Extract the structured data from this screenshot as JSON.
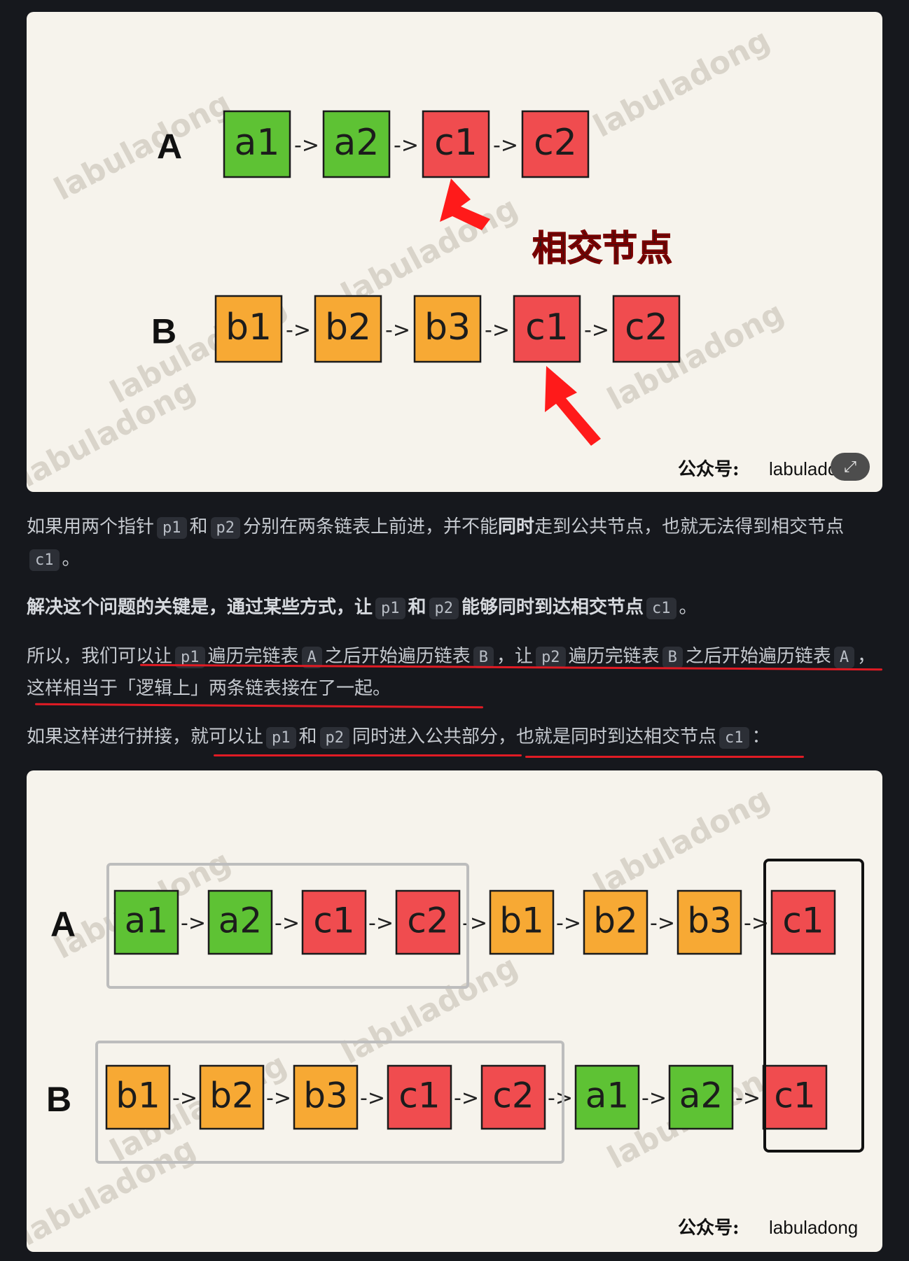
{
  "colors": {
    "green": "#5ec234",
    "orange": "#f7a934",
    "red": "#f04c4f",
    "arrow_red": "#ff1a1a",
    "underline_red": "#e01b24"
  },
  "figure1": {
    "row_a": {
      "label": "A",
      "nodes": [
        {
          "text": "a1",
          "color": "green"
        },
        {
          "text": "a2",
          "color": "green"
        },
        {
          "text": "c1",
          "color": "red"
        },
        {
          "text": "c2",
          "color": "red"
        }
      ]
    },
    "row_b": {
      "label": "B",
      "nodes": [
        {
          "text": "b1",
          "color": "orange"
        },
        {
          "text": "b2",
          "color": "orange"
        },
        {
          "text": "b3",
          "color": "orange"
        },
        {
          "text": "c1",
          "color": "red"
        },
        {
          "text": "c2",
          "color": "red"
        }
      ]
    },
    "arrow_text": "->",
    "callout": "相交节点",
    "credit_brand": "公众号:",
    "credit_name": "labuladong",
    "watermark": "labuladong",
    "expand_icon": "⤢"
  },
  "figure2": {
    "row_a": {
      "label": "A",
      "nodes": [
        {
          "text": "a1",
          "color": "green"
        },
        {
          "text": "a2",
          "color": "green"
        },
        {
          "text": "c1",
          "color": "red"
        },
        {
          "text": "c2",
          "color": "red"
        },
        {
          "text": "b1",
          "color": "orange"
        },
        {
          "text": "b2",
          "color": "orange"
        },
        {
          "text": "b3",
          "color": "orange"
        },
        {
          "text": "c1",
          "color": "red"
        }
      ]
    },
    "row_b": {
      "label": "B",
      "nodes": [
        {
          "text": "b1",
          "color": "orange"
        },
        {
          "text": "b2",
          "color": "orange"
        },
        {
          "text": "b3",
          "color": "orange"
        },
        {
          "text": "c1",
          "color": "red"
        },
        {
          "text": "c2",
          "color": "red"
        },
        {
          "text": "a1",
          "color": "green"
        },
        {
          "text": "a2",
          "color": "green"
        },
        {
          "text": "c1",
          "color": "red"
        }
      ]
    },
    "arrow_text": "->",
    "credit_brand": "公众号:",
    "credit_name": "labuladong",
    "watermark": "labuladong"
  },
  "para1": {
    "t1": "如果用两个指针",
    "c1": "p1",
    "t2": "和",
    "c2": "p2",
    "t3": "分别在两条链表上前进，并不能",
    "b1": "同时",
    "t4": "走到公共节点，也就无法得到相交节点",
    "c3": "c1",
    "t5": "。"
  },
  "para2": {
    "b1": "解决这个问题的关键是，通过某些方式，让",
    "c1": "p1",
    "b2": "和",
    "c2": "p2",
    "b3": "能够同时到达相交节点",
    "c3": "c1",
    "t1": "。"
  },
  "para3": {
    "t1": "所以，我们可以让",
    "c1": "p1",
    "t2": "遍历完链表",
    "c2": "A",
    "t3": "之后开始遍历链表",
    "c3": "B",
    "t4": "，让",
    "c4": "p2",
    "t5": "遍历完链表",
    "c5": "B",
    "t6": "之后开始遍历链表",
    "c6": "A",
    "t7": "，这样相当于「逻辑上」两条链表接在了一起。"
  },
  "para4": {
    "t1": "如果这样进行拼接，就可以让",
    "c1": "p1",
    "t2": "和",
    "c2": "p2",
    "t3": "同时进入公共部分，也就是同时到达相交节点",
    "c3": "c1",
    "t4": "："
  }
}
